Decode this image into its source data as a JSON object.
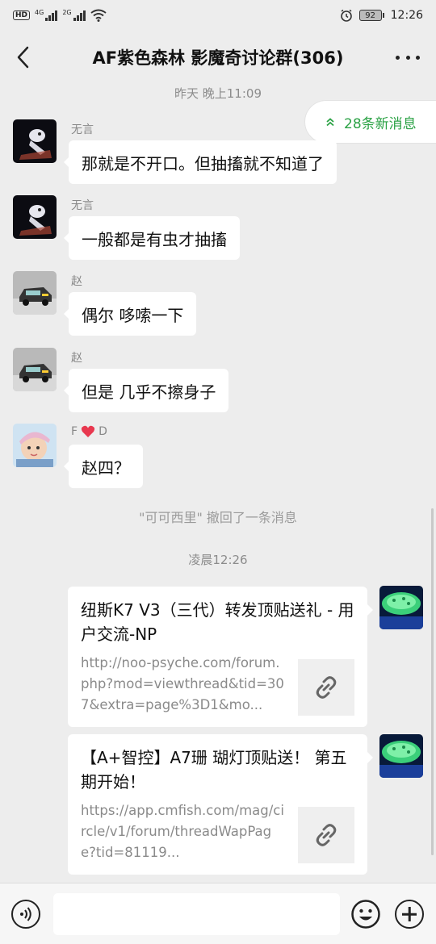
{
  "status_bar": {
    "network_hd": "HD",
    "sim1": "4G",
    "sim2": "2G",
    "battery": "92",
    "time": "12:26"
  },
  "nav": {
    "title": "AF紫色森林 影魔奇讨论群(306)"
  },
  "new_messages": "28条新消息",
  "timestamps": [
    "昨天 晚上11:09",
    "凌晨12:26"
  ],
  "messages": [
    {
      "sender": "无言",
      "text": "那就是不开口。但抽搐就不知道了",
      "avatar": "robot-figure-avatar"
    },
    {
      "sender": "无言",
      "text": "一般都是有虫才抽搐",
      "avatar": "robot-figure-avatar"
    },
    {
      "sender": "赵",
      "text": "偶尔 哆嗦一下",
      "avatar": "car-avatar"
    },
    {
      "sender": "赵",
      "text": "但是 几乎不擦身子",
      "avatar": "car-avatar"
    },
    {
      "sender_prefix": "F",
      "sender_suffix": "D",
      "text": "赵四？",
      "avatar": "baby-avatar"
    }
  ],
  "revoke_notice": "\"可可西里\" 撤回了一条消息",
  "link_cards": [
    {
      "title": "纽斯K7 V3（三代）转发顶贴送礼 - 用户交流-NP",
      "desc": "http://noo-psyche.com/forum.php?mod=viewthread&tid=307&extra=page%3D1&mo...",
      "icon": "link-icon"
    },
    {
      "title": "【A+智控】A7珊 瑚灯顶贴送！ 第五期开始！",
      "desc": "https://app.cmfish.com/mag/circle/v1/forum/threadWapPage?tid=81119...",
      "icon": "link-icon"
    }
  ],
  "colors": {
    "background": "#ededed",
    "accent_green": "#2ba245",
    "bubble": "#ffffff"
  }
}
